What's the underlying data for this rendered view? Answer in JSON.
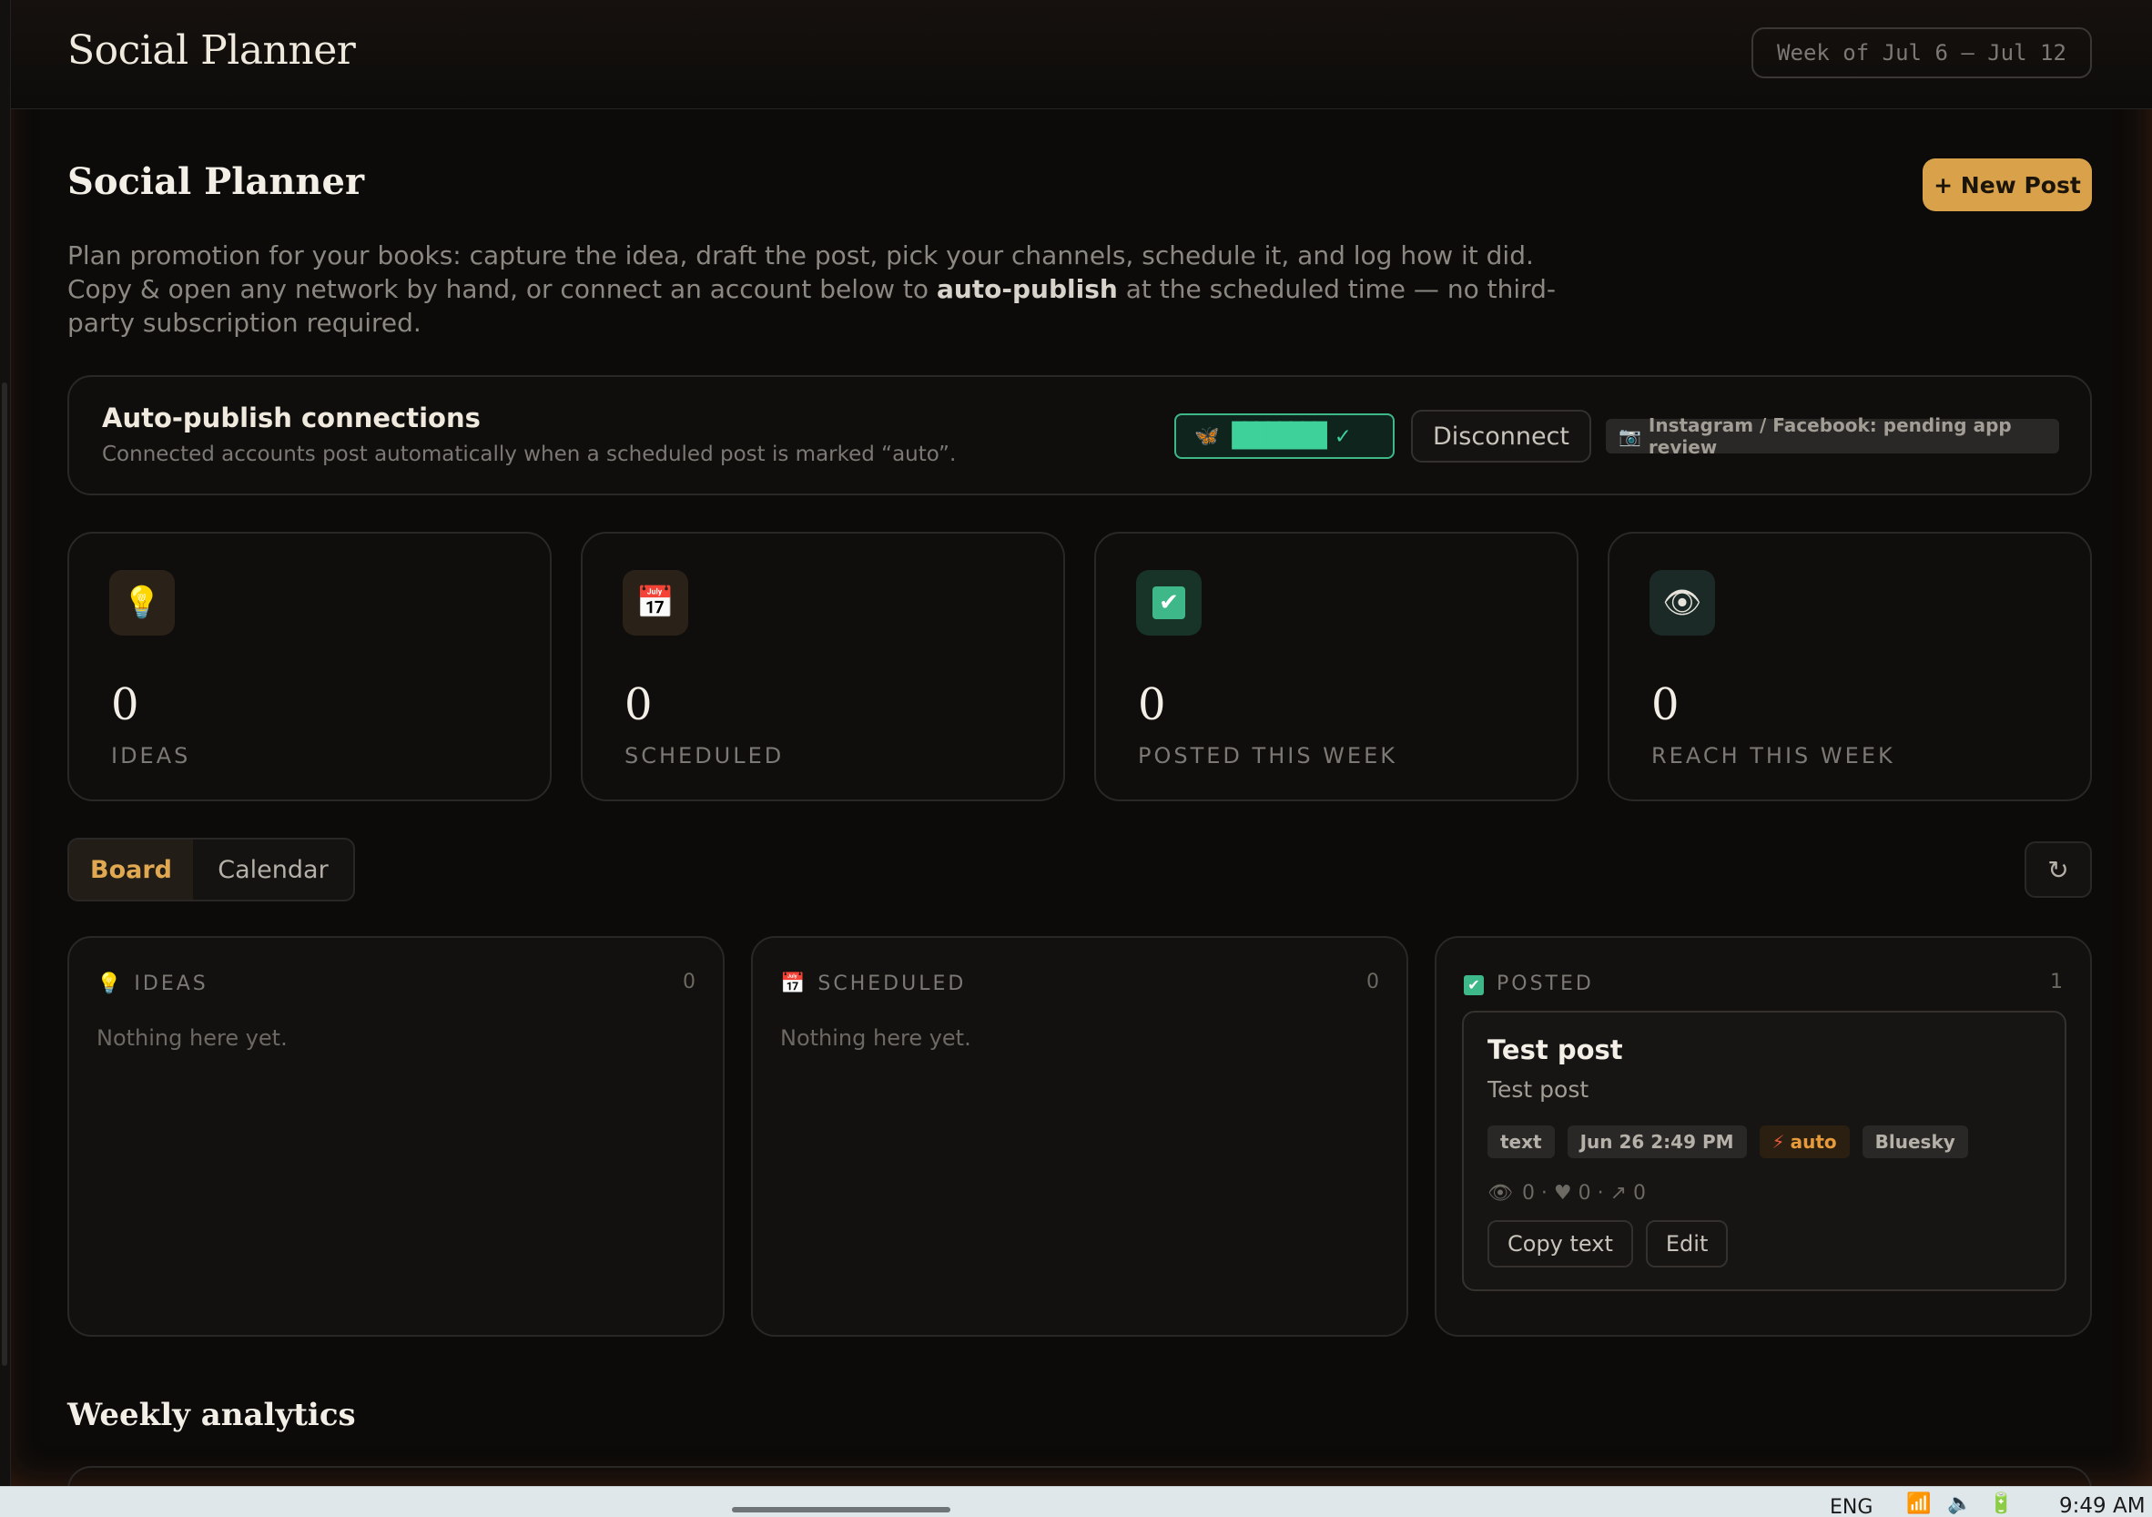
{
  "app": {
    "brand": "Social Planner",
    "week_range": "Week of Jul 6 – Jul 12"
  },
  "header": {
    "title": "Social Planner",
    "new_post_label": "+ New Post",
    "intro_before": "Plan promotion for your books: capture the idea, draft the post, pick your channels, schedule it, and log how it did. Copy & open any network by hand, or connect an account below to ",
    "intro_bold": "auto-publish",
    "intro_after": " at the scheduled time — no third-party subscription required."
  },
  "connections": {
    "title": "Auto-publish connections",
    "subtitle": "Connected accounts post automatically when a scheduled post is marked “auto”.",
    "bluesky_icon": "butterfly-icon",
    "bluesky_chip": "████████ ✓",
    "disconnect_label": "Disconnect",
    "pending_icon": "camera-icon",
    "pending_text": "Instagram / Facebook: pending app review"
  },
  "stats": [
    {
      "icon": "lightbulb-icon",
      "glyph": "💡",
      "value": "0",
      "label": "IDEAS"
    },
    {
      "icon": "calendar-icon",
      "glyph": "📅",
      "value": "0",
      "label": "SCHEDULED"
    },
    {
      "icon": "checkmark-icon",
      "glyph": "✔",
      "value": "0",
      "label": "POSTED THIS WEEK"
    },
    {
      "icon": "eye-icon",
      "glyph": "👁",
      "value": "0",
      "label": "REACH THIS WEEK"
    }
  ],
  "view_tabs": [
    {
      "label": "Board",
      "active": true
    },
    {
      "label": "Calendar",
      "active": false
    }
  ],
  "refresh_glyph": "↻",
  "columns": [
    {
      "title": "IDEAS",
      "icon": "lightbulb-icon",
      "glyph": "💡",
      "count": "0",
      "empty_text": "Nothing here yet."
    },
    {
      "title": "SCHEDULED",
      "icon": "calendar-icon",
      "glyph": "📅",
      "count": "0",
      "empty_text": "Nothing here yet."
    },
    {
      "title": "POSTED",
      "icon": "checkmark-icon",
      "glyph": "✅",
      "count": "1"
    }
  ],
  "posted_card": {
    "title": "Test post",
    "body": "Test post",
    "tags": {
      "type": "text",
      "datetime": "Jun 26 2:49 PM",
      "auto_icon": "lightning-icon",
      "auto": "auto",
      "network": "Bluesky"
    },
    "metrics": {
      "eye_icon": "eye-icon",
      "text": "0 · ♥ 0 · ↗ 0"
    },
    "copy_label": "Copy text",
    "edit_label": "Edit"
  },
  "weekly_title": "Weekly analytics",
  "taskbar": {
    "lang": "ENG",
    "time": "9:49 AM"
  },
  "colors": {
    "accent": "#d9a24a",
    "bluesky_green": "#3fb889",
    "bg": "#0c0b0a"
  }
}
